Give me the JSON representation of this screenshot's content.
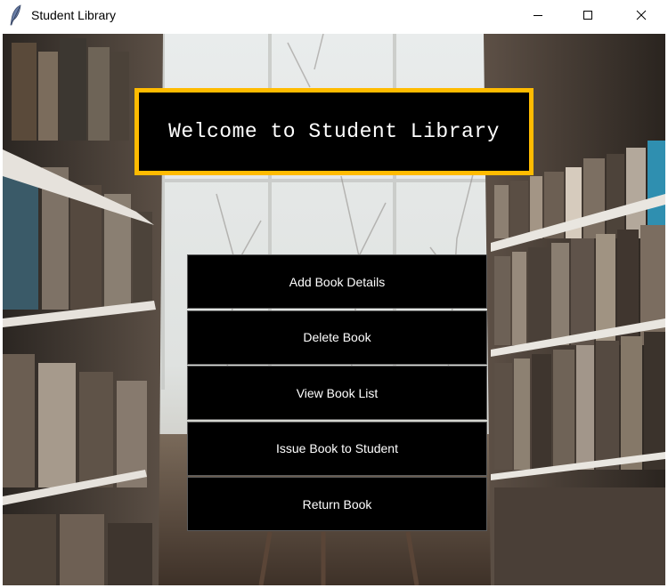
{
  "window": {
    "title": "Student Library",
    "icon": "feather-icon",
    "controls": [
      "minimize-icon",
      "maximize-icon",
      "close-icon"
    ]
  },
  "heading": {
    "text": "Welcome to Student Library",
    "border_color": "#ffbb00",
    "background_color": "#000000",
    "text_color": "#ffffff"
  },
  "menu": {
    "buttons": [
      {
        "label": "Add Book Details"
      },
      {
        "label": "Delete Book"
      },
      {
        "label": "View Book List"
      },
      {
        "label": "Issue Book to Student"
      },
      {
        "label": "Return Book"
      }
    ],
    "button_background": "#000000",
    "button_text_color": "#ffffff"
  },
  "background": {
    "description_icon": "library-background-image"
  }
}
